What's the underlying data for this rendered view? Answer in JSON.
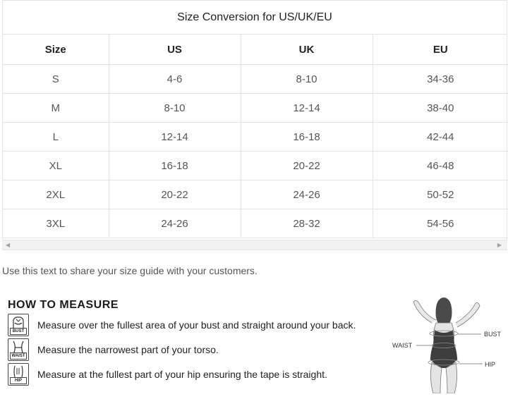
{
  "table": {
    "title": "Size Conversion for US/UK/EU",
    "headers": [
      "Size",
      "US",
      "UK",
      "EU"
    ],
    "rows": [
      [
        "S",
        "4-6",
        "8-10",
        "34-36"
      ],
      [
        "M",
        "8-10",
        "12-14",
        "38-40"
      ],
      [
        "L",
        "12-14",
        "16-18",
        "42-44"
      ],
      [
        "XL",
        "16-18",
        "20-22",
        "46-48"
      ],
      [
        "2XL",
        "20-22",
        "24-26",
        "50-52"
      ],
      [
        "3XL",
        "24-26",
        "28-32",
        "54-56"
      ]
    ]
  },
  "share_note": "Use this text to share your size guide with your customers.",
  "measure": {
    "heading": "HOW TO MEASURE",
    "items": [
      {
        "icon_label": "BUST",
        "icon": "bust-icon",
        "text": "Measure over the fullest area of your bust and straight around your back."
      },
      {
        "icon_label": "WAIST",
        "icon": "waist-icon",
        "text": "Measure the narrowest part of your torso."
      },
      {
        "icon_label": "HIP",
        "icon": "hip-icon",
        "text": "Measure at the fullest part of your hip ensuring the tape is straight."
      }
    ],
    "figure_labels": {
      "bust": "BUST",
      "waist": "WAIST",
      "hip": "HIP"
    }
  }
}
